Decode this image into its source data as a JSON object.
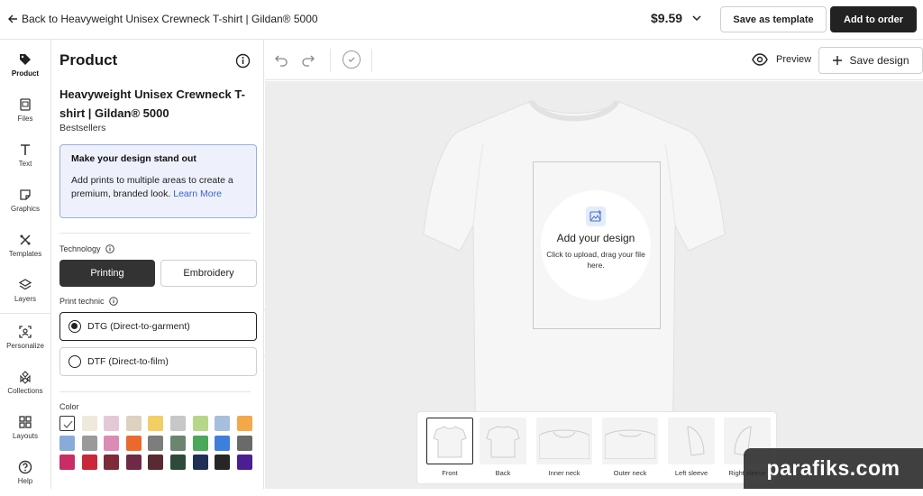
{
  "topbar": {
    "back_label": "Back to Heavyweight Unisex Crewneck T-shirt | Gildan® 5000",
    "price": "$9.59",
    "save_template": "Save as template",
    "add_to_order": "Add to order"
  },
  "nav": {
    "items": [
      {
        "label": "Product",
        "icon": "tag-icon"
      },
      {
        "label": "Files",
        "icon": "files-icon"
      },
      {
        "label": "Text",
        "icon": "text-icon"
      },
      {
        "label": "Graphics",
        "icon": "graphics-icon"
      },
      {
        "label": "Templates",
        "icon": "templates-icon"
      },
      {
        "label": "Layers",
        "icon": "layers-icon"
      },
      {
        "label": "Personalize",
        "icon": "personalize-icon"
      },
      {
        "label": "Collections",
        "icon": "collections-icon"
      },
      {
        "label": "Layouts",
        "icon": "layouts-icon"
      },
      {
        "label": "Help",
        "icon": "help-icon"
      }
    ]
  },
  "panel": {
    "title": "Product",
    "product_name": "Heavyweight Unisex Crewneck T-shirt | Gildan® 5000",
    "category": "Bestsellers",
    "promo": {
      "title": "Make your design stand out",
      "body": "Add prints to multiple areas to create a premium, branded look.",
      "link": "Learn More"
    },
    "technology_label": "Technology",
    "technology_options": [
      "Printing",
      "Embroidery"
    ],
    "technology_selected": "Printing",
    "print_technic_label": "Print technic",
    "print_options": [
      "DTG (Direct-to-garment)",
      "DTF (Direct-to-film)"
    ],
    "print_selected": "DTG (Direct-to-garment)",
    "color_label": "Color",
    "colors": [
      [
        "#ffffff",
        "#efe8dc",
        "#e3c9d6",
        "#ddd2c0",
        "#f3cf63",
        "#c7c7c7",
        "#b6d78a",
        "#a7bfdc",
        "#f3a94a"
      ],
      [
        "#8aabd9",
        "#9a9a9a",
        "#dc8bb4",
        "#ea6a2e",
        "#7d7d7d",
        "#6b8570",
        "#49a85a",
        "#3f7fdc",
        "#6a6a6a"
      ],
      [
        "#c92c66",
        "#c8283a",
        "#7d2a3a",
        "#6e2a44",
        "#5a2a33",
        "#2f4a3b",
        "#1f2f55",
        "#262626",
        "#4b1e92"
      ]
    ],
    "selected_color": "#ffffff"
  },
  "toolbar": {
    "preview": "Preview",
    "save_design": "Save design"
  },
  "canvas": {
    "drop_title": "Add your design",
    "drop_sub": "Click to upload, drag your file here."
  },
  "views": [
    {
      "label": "Front"
    },
    {
      "label": "Back"
    },
    {
      "label": "Inner neck"
    },
    {
      "label": "Outer neck"
    },
    {
      "label": "Left sleeve"
    },
    {
      "label": "Right sleeve"
    }
  ],
  "watermark": "parafiks.com"
}
